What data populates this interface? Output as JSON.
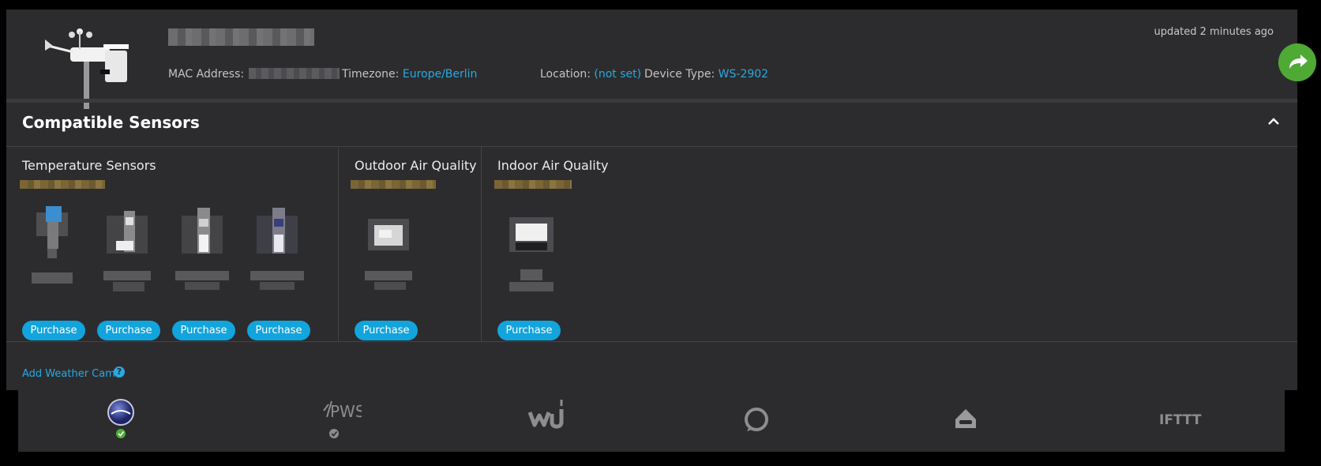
{
  "header": {
    "updated": "updated 2 minutes ago",
    "mac_label": "MAC Address:",
    "timezone_label": "Timezone:",
    "timezone_value": "Europe/Berlin",
    "location_label": "Location:",
    "location_value": "(not set)",
    "device_type_label": "Device Type:",
    "device_type_value": "WS-2902"
  },
  "sensors": {
    "title": "Compatible Sensors",
    "groups": [
      {
        "title": "Temperature Sensors",
        "buttons": [
          "Purchase",
          "Purchase",
          "Purchase",
          "Purchase"
        ]
      },
      {
        "title": "Outdoor Air Quality",
        "buttons": [
          "Purchase"
        ]
      },
      {
        "title": "Indoor Air Quality",
        "buttons": [
          "Purchase"
        ]
      }
    ],
    "add_cam": "Add Weather Cam",
    "help_glyph": "?"
  },
  "services": [
    {
      "name": "ambient-weather-icon",
      "status": "connected"
    },
    {
      "name": "pws-icon",
      "label": "PWS",
      "status": "enabled"
    },
    {
      "name": "wunderground-icon"
    },
    {
      "name": "alexa-icon"
    },
    {
      "name": "google-home-icon"
    },
    {
      "name": "ifttt-icon",
      "label": "IFTTT"
    }
  ],
  "colors": {
    "accent": "#29a9e1",
    "button": "#12a4dd",
    "share": "#4fa935",
    "background": "#2c2c2e"
  }
}
